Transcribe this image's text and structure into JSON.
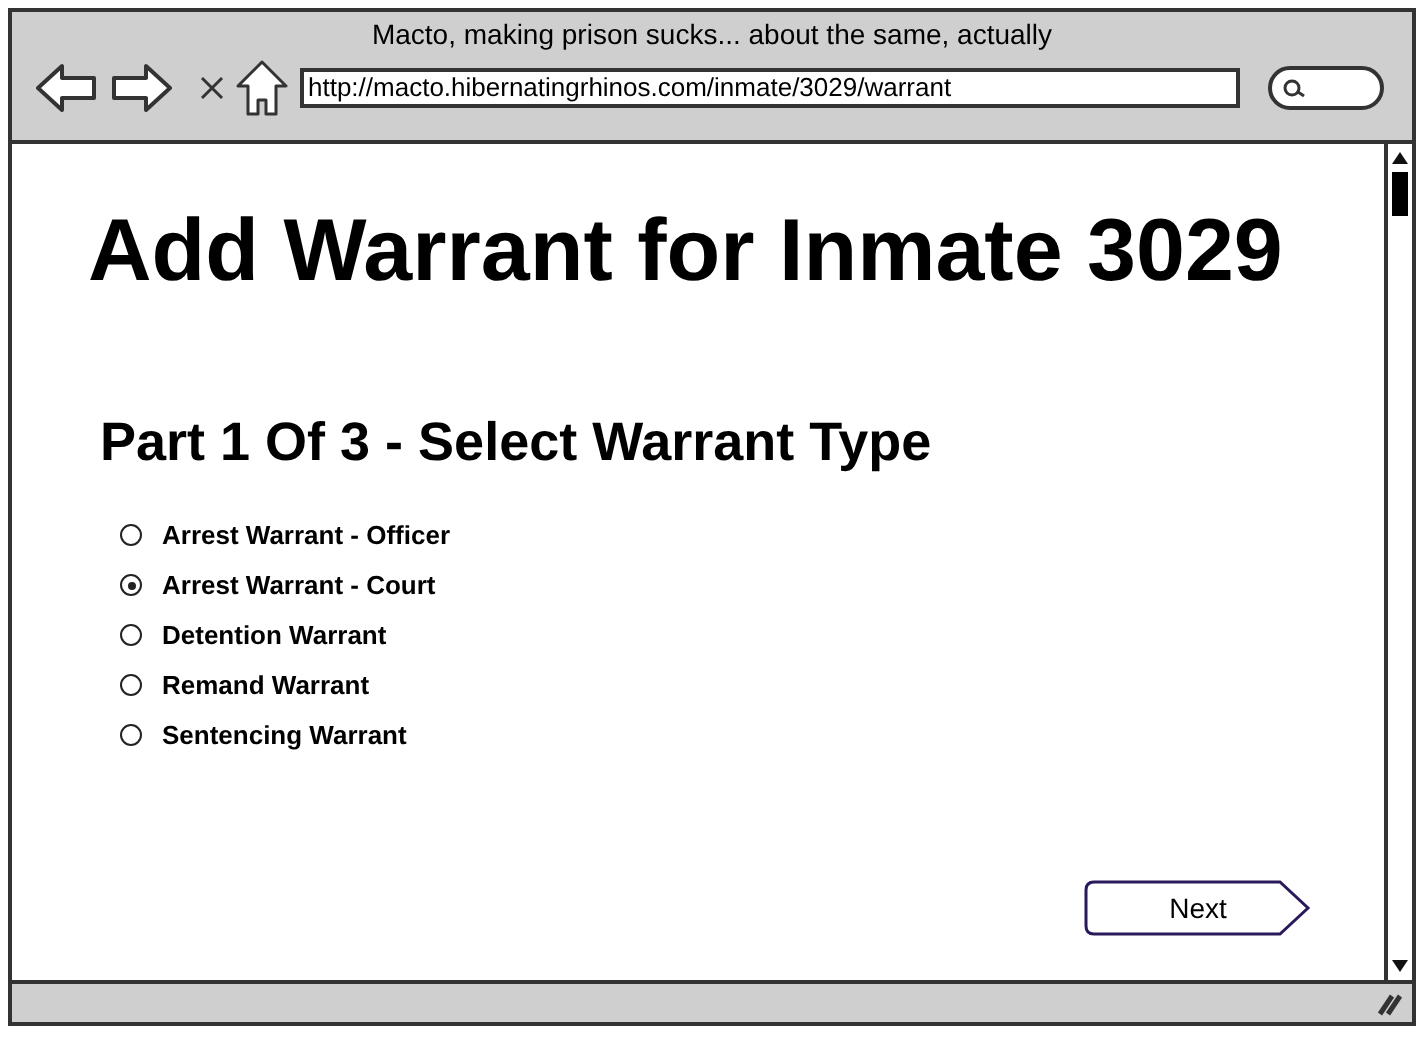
{
  "window": {
    "title": "Macto, making prison sucks... about the same, actually"
  },
  "address_bar": {
    "url": "http://macto.hibernatingrhinos.com/inmate/3029/warrant"
  },
  "page": {
    "heading": "Add Warrant for Inmate 3029",
    "subheading": "Part 1 Of 3 - Select Warrant Type",
    "warrant_types": [
      {
        "label": "Arrest Warrant - Officer",
        "selected": false
      },
      {
        "label": "Arrest Warrant - Court",
        "selected": true
      },
      {
        "label": "Detention Warrant",
        "selected": false
      },
      {
        "label": "Remand Warrant",
        "selected": false
      },
      {
        "label": "Sentencing Warrant",
        "selected": false
      }
    ],
    "next_button": "Next"
  }
}
